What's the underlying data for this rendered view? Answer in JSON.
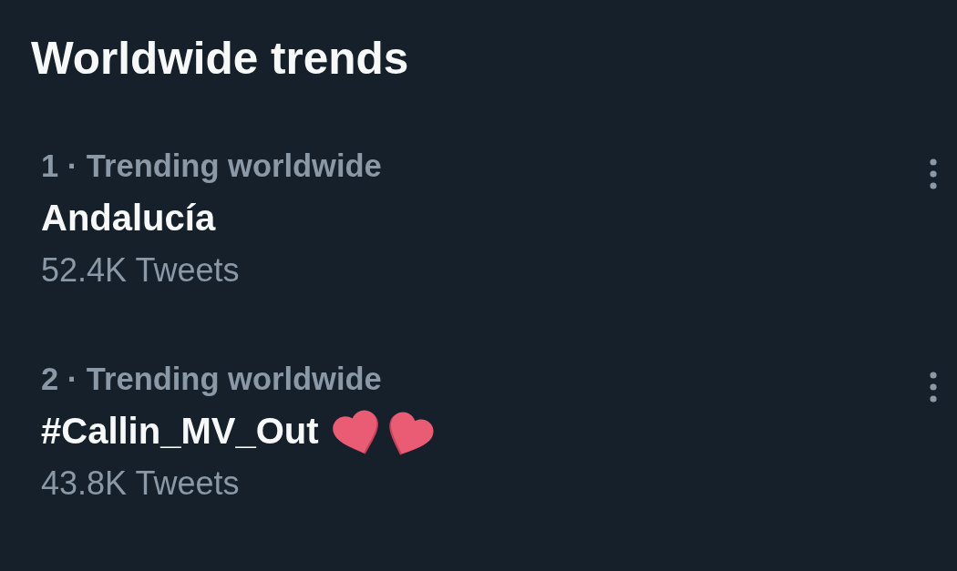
{
  "title": "Worldwide trends",
  "trends": [
    {
      "context": "1 · Trending worldwide",
      "name": "Andalucía",
      "emoji": false,
      "count": "52.4K Tweets"
    },
    {
      "context": "2 · Trending worldwide",
      "name": "#Callin_MV_Out",
      "emoji": true,
      "count": "43.8K Tweets"
    }
  ]
}
